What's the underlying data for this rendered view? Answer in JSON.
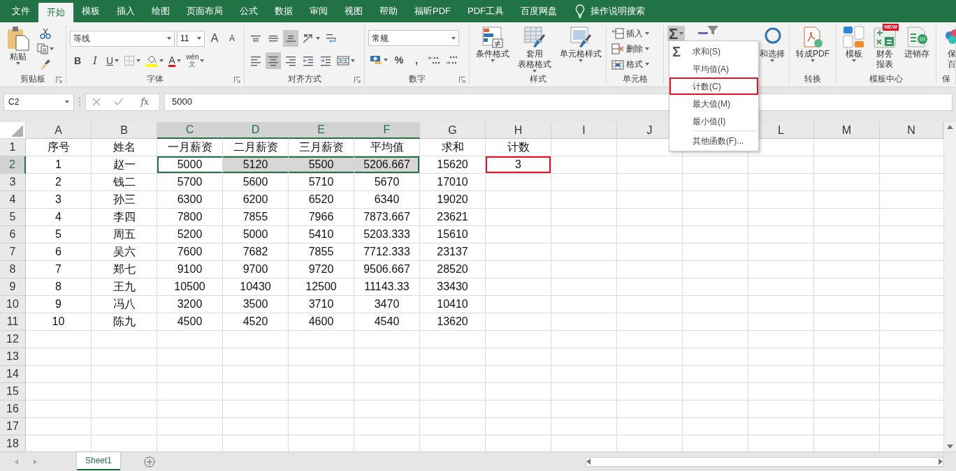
{
  "tabs": [
    {
      "label": "文件",
      "selected": false
    },
    {
      "label": "开始",
      "selected": true
    },
    {
      "label": "模板",
      "selected": false
    },
    {
      "label": "插入",
      "selected": false
    },
    {
      "label": "绘图",
      "selected": false
    },
    {
      "label": "页面布局",
      "selected": false
    },
    {
      "label": "公式",
      "selected": false
    },
    {
      "label": "数据",
      "selected": false
    },
    {
      "label": "审阅",
      "selected": false
    },
    {
      "label": "视图",
      "selected": false
    },
    {
      "label": "帮助",
      "selected": false
    },
    {
      "label": "福昕PDF",
      "selected": false
    },
    {
      "label": "PDF工具",
      "selected": false
    },
    {
      "label": "百度网盘",
      "selected": false
    }
  ],
  "search": {
    "label": "操作说明搜索"
  },
  "ribbon": {
    "groups": [
      {
        "label": "剪贴板",
        "launcher": true,
        "items": [
          {
            "kind": "large",
            "lines": [
              "粘贴"
            ],
            "caret": true
          },
          {
            "kind": "icon"
          },
          {
            "kind": "icon",
            "caret": true
          },
          {
            "kind": "icon"
          }
        ]
      },
      {
        "label": "字体",
        "launcher": true,
        "items": [
          {
            "kind": "field",
            "value": "等线"
          },
          {
            "kind": "field",
            "value": "11"
          },
          {
            "kind": "glyph",
            "label": "A"
          },
          {
            "kind": "glyph",
            "label": "A"
          },
          {
            "kind": "glyph",
            "label": "B"
          },
          {
            "kind": "glyph",
            "label": "I"
          },
          {
            "kind": "glyph",
            "label": "U",
            "caret": true
          },
          {
            "kind": "icon",
            "caret": true
          },
          {
            "kind": "icon",
            "caret": true
          },
          {
            "kind": "glyph",
            "label": "A",
            "caret": true
          },
          {
            "kind": "glyph",
            "label": "wén",
            "sub": "文",
            "caret": true
          }
        ]
      },
      {
        "label": "对齐方式",
        "launcher": true,
        "items": [
          {
            "kind": "icon",
            "pressed": false
          },
          {
            "kind": "icon",
            "pressed": false
          },
          {
            "kind": "icon",
            "pressed": true
          },
          {
            "kind": "icon",
            "pressed": false,
            "caret": true
          },
          {
            "kind": "icon",
            "pressed": false
          },
          {
            "kind": "icon",
            "pressed": false
          },
          {
            "kind": "icon",
            "pressed": true
          },
          {
            "kind": "icon",
            "pressed": false
          },
          {
            "kind": "icon",
            "pressed": false
          },
          {
            "kind": "icon",
            "pressed": false
          },
          {
            "kind": "icon",
            "pressed": false,
            "caret": true
          }
        ]
      },
      {
        "label": "数字",
        "launcher": true,
        "items": [
          {
            "kind": "field",
            "value": "常规"
          },
          {
            "kind": "icon",
            "caret": true
          },
          {
            "kind": "glyph",
            "label": "%"
          },
          {
            "kind": "glyph",
            "label": ","
          },
          {
            "kind": "icon"
          },
          {
            "kind": "icon"
          }
        ]
      },
      {
        "label": "样式",
        "items": [
          {
            "kind": "large",
            "lines": [
              "条件格式"
            ],
            "caret": true
          },
          {
            "kind": "large",
            "lines": [
              "套用",
              "表格格式"
            ],
            "caret": true
          },
          {
            "kind": "large",
            "lines": [
              "单元格样式"
            ],
            "caret": true
          }
        ]
      },
      {
        "label": "单元格",
        "items": [
          {
            "kind": "small",
            "label": "插入",
            "caret": true
          },
          {
            "kind": "small",
            "label": "删除",
            "caret": true
          },
          {
            "kind": "small",
            "label": "格式",
            "caret": true
          }
        ]
      },
      {
        "items": [
          {
            "kind": "glyph",
            "label": "Σ",
            "caret": true,
            "pressed": true
          },
          {
            "kind": "large"
          },
          {
            "kind": "large",
            "lines": [
              "和选择"
            ],
            "caret": true
          }
        ]
      },
      {
        "label": "转换",
        "items": [
          {
            "kind": "large",
            "lines": [
              "转成PDF"
            ],
            "caret": true
          }
        ]
      },
      {
        "label": "模板中心",
        "items": [
          {
            "kind": "large",
            "lines": [
              "模板"
            ],
            "caret": true
          },
          {
            "kind": "large",
            "lines": [
              "财务",
              "报表"
            ],
            "badge": "NEW"
          },
          {
            "kind": "large",
            "lines": [
              "进销存"
            ]
          }
        ]
      },
      {
        "label": "保",
        "items": [
          {
            "kind": "large",
            "lines": [
              "保",
              "百"
            ]
          }
        ]
      }
    ]
  },
  "formula_bar": {
    "name_box": "C2",
    "function_label": "fx",
    "formula": "5000"
  },
  "sheet": {
    "columns": [
      {
        "label": "A",
        "selected": false
      },
      {
        "label": "B",
        "selected": false
      },
      {
        "label": "C",
        "selected": true
      },
      {
        "label": "D",
        "selected": true
      },
      {
        "label": "E",
        "selected": true
      },
      {
        "label": "F",
        "selected": true
      },
      {
        "label": "G",
        "selected": false
      },
      {
        "label": "H",
        "selected": false
      },
      {
        "label": "I",
        "selected": false
      },
      {
        "label": "J",
        "selected": false
      },
      null,
      {
        "label": "L",
        "selected": false
      },
      {
        "label": "M",
        "selected": false
      },
      {
        "label": "N",
        "selected": false
      }
    ],
    "rows": [
      {
        "number": "1",
        "selected": false,
        "cells": [
          "序号",
          "姓名",
          "一月薪资",
          "二月薪资",
          "三月薪资",
          "平均值",
          "求和",
          "计数"
        ]
      },
      {
        "number": "2",
        "selected": true,
        "cells": [
          {
            "text": "1",
            "selected": false
          },
          {
            "text": "赵一",
            "selected": false
          },
          {
            "text": "5000",
            "selected": true,
            "active": true
          },
          {
            "text": "5120",
            "selected": true
          },
          {
            "text": "5500",
            "selected": true
          },
          {
            "text": "5206.667",
            "selected": true
          },
          {
            "text": "15620",
            "selected": false
          },
          {
            "text": "3",
            "selected": false,
            "highlighted": true
          }
        ]
      },
      {
        "number": "3",
        "selected": false,
        "cells": [
          "2",
          "钱二",
          "5700",
          "5600",
          "5710",
          "5670",
          "17010"
        ]
      },
      {
        "number": "4",
        "selected": false,
        "cells": [
          "3",
          "孙三",
          "6300",
          "6200",
          "6520",
          "6340",
          "19020"
        ]
      },
      {
        "number": "5",
        "selected": false,
        "cells": [
          "4",
          "李四",
          "7800",
          "7855",
          "7966",
          "7873.667",
          "23621"
        ]
      },
      {
        "number": "6",
        "selected": false,
        "cells": [
          "5",
          "周五",
          "5200",
          "5000",
          "5410",
          "5203.333",
          "15610"
        ]
      },
      {
        "number": "7",
        "selected": false,
        "cells": [
          "6",
          "吴六",
          "7600",
          "7682",
          "7855",
          "7712.333",
          "23137"
        ]
      },
      {
        "number": "8",
        "selected": false,
        "cells": [
          "7",
          "郑七",
          "9100",
          "9700",
          "9720",
          "9506.667",
          "28520"
        ]
      },
      {
        "number": "9",
        "selected": false,
        "cells": [
          "8",
          "王九",
          "10500",
          "10430",
          "12500",
          "11143.33",
          "33430"
        ]
      },
      {
        "number": "10",
        "selected": false,
        "cells": [
          "9",
          "冯八",
          "3200",
          "3500",
          "3710",
          "3470",
          "10410"
        ]
      },
      {
        "number": "11",
        "selected": false,
        "cells": [
          "10",
          "陈九",
          "4500",
          "4520",
          "4600",
          "4540",
          "13620"
        ]
      },
      {
        "number": "12",
        "selected": false
      },
      {
        "number": "13",
        "selected": false
      },
      {
        "number": "14",
        "selected": false
      },
      {
        "number": "15",
        "selected": false
      },
      {
        "number": "16",
        "selected": false
      },
      {
        "number": "17",
        "selected": false
      },
      {
        "number": "18",
        "selected": false
      }
    ]
  },
  "autosum_menu": {
    "items": [
      {
        "kind": "sum",
        "symbol": "Σ",
        "label": "求和(S)",
        "highlighted": false
      },
      {
        "kind": "plain",
        "label": "平均值(A)",
        "highlighted": false
      },
      {
        "kind": "plain",
        "label": "计数(C)",
        "highlighted": true
      },
      {
        "kind": "plain",
        "label": "最大值(M)",
        "highlighted": false
      },
      {
        "kind": "plain",
        "label": "最小值(I)",
        "highlighted": false
      },
      {
        "kind": "plain",
        "label": "其他函数(F)...",
        "highlighted": false,
        "separator_before": true
      }
    ]
  },
  "sheet_tabs": [
    {
      "label": "Sheet1",
      "selected": true
    }
  ]
}
